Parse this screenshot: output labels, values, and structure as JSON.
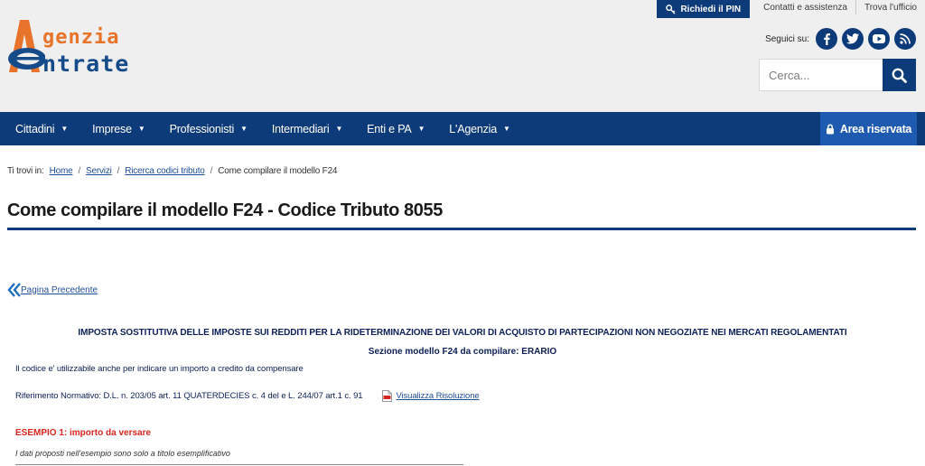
{
  "brand": {
    "word1": "genzia",
    "word2": "ntrate",
    "orange": "#e8732a",
    "blue": "#164b8a"
  },
  "top_links": {
    "pin": "Richiedi il PIN",
    "contacts": "Contatti e assistenza",
    "office": "Trova l'ufficio"
  },
  "social": {
    "label": "Seguici su:",
    "icons": [
      "facebook-icon",
      "twitter-icon",
      "youtube-icon",
      "rss-icon"
    ]
  },
  "search": {
    "placeholder": "Cerca..."
  },
  "nav": {
    "items": [
      {
        "label": "Cittadini"
      },
      {
        "label": "Imprese"
      },
      {
        "label": "Professionisti"
      },
      {
        "label": "Intermediari"
      },
      {
        "label": "Enti e PA"
      },
      {
        "label": "L'Agenzia"
      }
    ],
    "reserved": "Area riservata",
    "bar_color": "#0d3a78",
    "reserved_color": "#1e5bb0"
  },
  "breadcrumb": {
    "prefix": "Ti trovi in:",
    "items": [
      "Home",
      "Servizi",
      "Ricerca codici tributo"
    ],
    "current": "Come compilare il modello F24"
  },
  "page": {
    "title": "Come compilare il modello F24 - Codice Tributo 8055",
    "back": "Pagina Precedente",
    "heading": "IMPOSTA SOSTITUTIVA DELLE IMPOSTE SUI REDDITI PER LA RIDETERMINAZIONE DEI VALORI DI ACQUISTO DI PARTECIPAZIONI NON NEGOZIATE NEI MERCATI REGOLAMENTATI",
    "section": "Sezione modello F24 da compilare: ERARIO",
    "note": "Il codice e' utilizzabile anche per indicare un importo a credito da compensare",
    "reference": "Riferimento Normativo: D.L. n. 203/05 art. 11  QUATERDECIES c. 4 del e L. 244/07 art.1 c. 91",
    "resolution_link": "Visualizza Risoluzione",
    "example_title": "ESEMPIO 1: importo da versare",
    "example_note": "I dati proposti nell'esempio sono solo a titolo esemplificativo"
  }
}
